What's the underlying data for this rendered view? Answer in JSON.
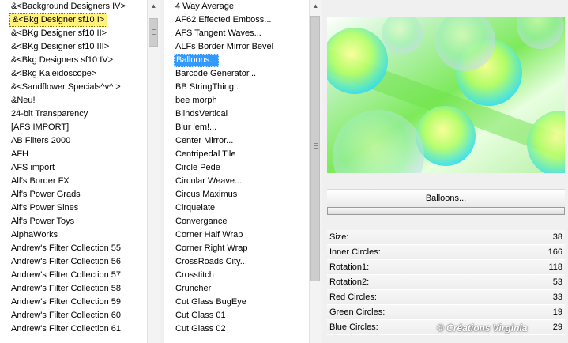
{
  "categories": [
    {
      "label": "&<Background Designers IV>"
    },
    {
      "label": "&<Bkg Designer sf10 I>",
      "selected": true
    },
    {
      "label": "&<BKg Designer sf10 II>"
    },
    {
      "label": "&<BKg Designer sf10 III>"
    },
    {
      "label": "&<Bkg Designers sf10 IV>"
    },
    {
      "label": "&<Bkg Kaleidoscope>"
    },
    {
      "label": "&<Sandflower Specials^v^ >"
    },
    {
      "label": "&Neu!"
    },
    {
      "label": "24-bit Transparency"
    },
    {
      "label": "[AFS IMPORT]"
    },
    {
      "label": "AB Filters 2000"
    },
    {
      "label": "AFH"
    },
    {
      "label": "AFS import"
    },
    {
      "label": "Alf's Border FX"
    },
    {
      "label": "Alf's Power Grads"
    },
    {
      "label": "Alf's Power Sines"
    },
    {
      "label": "Alf's Power Toys"
    },
    {
      "label": "AlphaWorks"
    },
    {
      "label": "Andrew's Filter Collection 55"
    },
    {
      "label": "Andrew's Filter Collection 56"
    },
    {
      "label": "Andrew's Filter Collection 57"
    },
    {
      "label": "Andrew's Filter Collection 58"
    },
    {
      "label": "Andrew's Filter Collection 59"
    },
    {
      "label": "Andrew's Filter Collection 60"
    },
    {
      "label": "Andrew's Filter Collection 61"
    }
  ],
  "filters": [
    {
      "label": "4 Way Average"
    },
    {
      "label": "AF62 Effected Emboss..."
    },
    {
      "label": "AFS Tangent Waves..."
    },
    {
      "label": "ALFs Border Mirror Bevel"
    },
    {
      "label": "Balloons...",
      "selected": true
    },
    {
      "label": "Barcode Generator..."
    },
    {
      "label": "BB StringThing.."
    },
    {
      "label": "bee morph"
    },
    {
      "label": "BlindsVertical"
    },
    {
      "label": "Blur 'em!..."
    },
    {
      "label": "Center Mirror..."
    },
    {
      "label": "Centripedal Tile"
    },
    {
      "label": "Circle Pede"
    },
    {
      "label": "Circular Weave..."
    },
    {
      "label": "Circus Maximus"
    },
    {
      "label": "Cirquelate"
    },
    {
      "label": "Convergance"
    },
    {
      "label": "Corner Half Wrap"
    },
    {
      "label": "Corner Right Wrap"
    },
    {
      "label": "CrossRoads City..."
    },
    {
      "label": "Crosstitch"
    },
    {
      "label": "Cruncher"
    },
    {
      "label": "Cut Glass  BugEye"
    },
    {
      "label": "Cut Glass 01"
    },
    {
      "label": "Cut Glass 02"
    }
  ],
  "selected_filter_name": "Balloons...",
  "params": [
    {
      "label": "Size:",
      "value": "38"
    },
    {
      "label": "Inner Circles:",
      "value": "166"
    },
    {
      "label": "Rotation1:",
      "value": "118"
    },
    {
      "label": "Rotation2:",
      "value": "53"
    },
    {
      "label": "Red Circles:",
      "value": "33"
    },
    {
      "label": "Green Circles:",
      "value": "19"
    },
    {
      "label": "Blue Circles:",
      "value": "29"
    }
  ],
  "watermark": "© Créations Virginia",
  "icons": {
    "scroll_up": "chevron-up-icon",
    "scroll_down": "chevron-down-icon"
  }
}
